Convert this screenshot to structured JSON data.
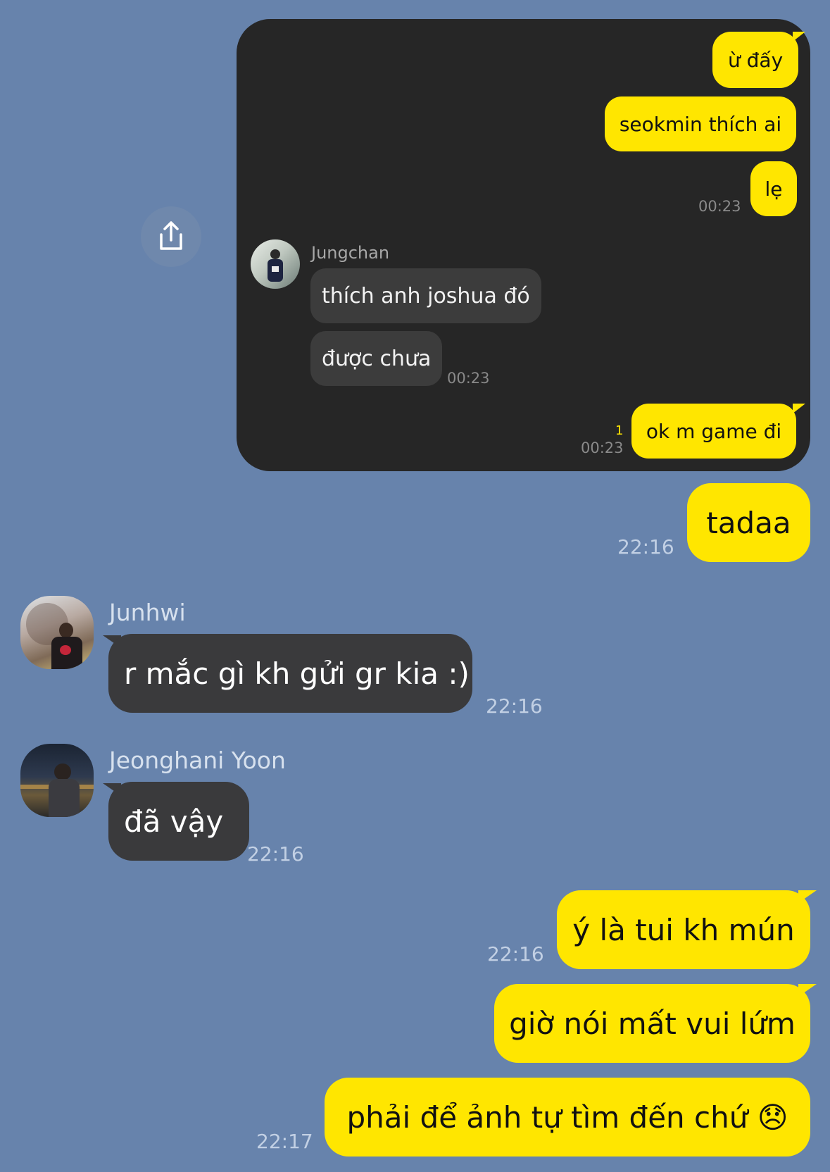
{
  "shared_screenshot": {
    "messages": [
      {
        "type": "sent",
        "text": "ừ đấy"
      },
      {
        "type": "sent",
        "text": "seokmin thích ai"
      },
      {
        "type": "sent",
        "text": "lẹ",
        "time": "00:23"
      },
      {
        "type": "received",
        "sender": "Jungchan",
        "text": "thích anh joshua đó"
      },
      {
        "type": "received",
        "text": "được chưa",
        "time": "00:23"
      },
      {
        "type": "sent",
        "text": "ok m game đi",
        "time": "00:23",
        "unread": "1"
      }
    ]
  },
  "chat": {
    "messages": [
      {
        "type": "sent",
        "text": "tadaa",
        "time": "22:16"
      },
      {
        "type": "received",
        "sender": "Junhwi",
        "text": "r mắc gì kh gửi gr kia :)",
        "time": "22:16"
      },
      {
        "type": "received",
        "sender": "Jeonghani Yoon",
        "text": "đã vậy",
        "time": "22:16"
      },
      {
        "type": "sent",
        "text": "ý là tui kh mún",
        "time": "22:16"
      },
      {
        "type": "sent",
        "text": "giờ nói mất vui lứm"
      },
      {
        "type": "sent",
        "text": "phải để ảnh tự tìm đến chứ 😞",
        "time": "22:17"
      }
    ]
  },
  "icons": {
    "share": "share-icon",
    "avatar_jungchan": "avatar-jungchan",
    "avatar_junhwi": "avatar-junhwi",
    "avatar_jeonghan": "avatar-jeonghan"
  },
  "colors": {
    "background": "#6783ac",
    "sent_bubble": "#ffe600",
    "received_bubble": "#3a3a3c",
    "card": "#262626"
  }
}
